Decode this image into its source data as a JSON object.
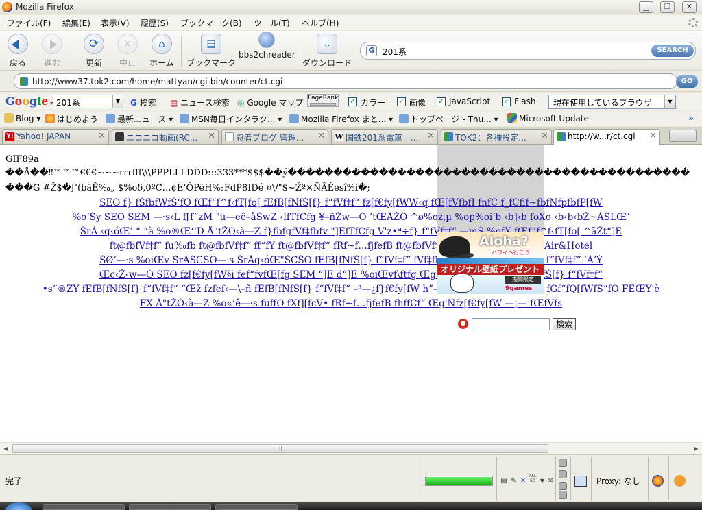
{
  "window": {
    "title": "Mozilla Firefox"
  },
  "menu": [
    "ファイル(F)",
    "編集(E)",
    "表示(V)",
    "履歴(S)",
    "ブックマーク(B)",
    "ツール(T)",
    "ヘルプ(H)"
  ],
  "nav": {
    "back": "戻る",
    "forward": "進む",
    "reload": "更新",
    "stop": "中止",
    "home": "ホーム",
    "bookmarks": "ブックマーク",
    "bbs2chreader": "bbs2chreader",
    "download": "ダウンロード"
  },
  "search": {
    "value": "201系",
    "button": "SEARCH"
  },
  "url": {
    "value": "http://www37.tok2.com/home/mattyan/cgi-bin/counter/ct.cgi",
    "go": "GO"
  },
  "googlebar": {
    "logo_g1": "G",
    "logo_o1": "o",
    "logo_o2": "o",
    "logo_g2": "g",
    "logo_l": "l",
    "logo_e": "e",
    "input": "201系",
    "search": "検索",
    "news": "ニュース検索",
    "maps": "Google マップ",
    "pagerank": "PageRank",
    "color": "カラー",
    "image": "画像",
    "javascript": "JavaScript",
    "flash": "Flash",
    "browser": "現在使用しているブラウザ"
  },
  "bookmarks": [
    "Blog",
    "はじめよう",
    "最新ニュース",
    "MSN毎日インタラク...",
    "Mozilla Firefox まと...",
    "トップページ - Thu...",
    "Microsoft Update"
  ],
  "tabs": [
    "Yahoo! JAPAN",
    "ニコニコ動画(RC...",
    "忍者ブログ 管理...",
    "国鉄201系電車 - ...",
    "TOK2：各種設定...",
    "http://w...r/ct.cgi"
  ],
  "content": {
    "header": "GIF89a",
    "garbled_1": "��Å��‼™™™€€€~~~rrrfff\\\\\\PPPLLLDDD:::333***$$$��ý��������������������������������������������",
    "garbled_2": "���G #Ž$�ƒ‘(bàÊ‰„ $%oδ,0ºC…¢È‘ÔPëH‰FdP8IDé ¤\\/\"$~Žª×ÑÂÉesî%i�;",
    "links": [
      "SEO f} fŠfbfWfŠ‘fO fŒf“f^f‹fT[fo[ fEfB[fNfŠ[f} f“fVf‡f“ fz[f€fy[fWW‹q fŒ[fVfbfI  fnfC f_fCfif~fbfNfpfbfP[fW",
      "%o‘Šy SEO SEM —·s‹L f[f“zM \"ü—eê–åŠwZ ‹lfTfCfg ¥–ñŽw—Ó ’tŒÄŽÔ ^ø%oz,µ %op%oi‘b  ‹b]‹b foXo ‹b‹b‹bŽ~ÁŠLŒ’",
      "ŠrÀ ‹q‹óŒ’ “ “à %o®Œ‘‘D Å\"tŽÒ‹à—Z f}fbfgfVf‡fbfv \"]EfTfCfg V'z•ª÷f} f“fVf‡f“ —mŠ  %ofX fŒf“f^f‹fT[fo[ ^ãŽt“]E",
      "ft@fbfVf‡f“ fu‰fb ft@fbfVf‡f“ ff“fY ft@fbfVf‡f“ fRf~f…fjfefB ft@fbfVf‡ @fbfVf‡f“ %oi‘â‹Ÿ—{ Air&Hotel",
      "ŠØ‘—·s %oiŒv ŠrÀŠCŠO—·s ŠrÀq‹óŒ\"ŠCŠO fEfB[fNfŠ[f} f“fVf‡f“ fVf‡fbfsf“fOf‚[f fEfB[fNfŠ[f} f“fVf‡f“ ’À‘Ý",
      "Œc‹Ž‹w—Ó SEO fz[f€fy[fW§i fef“fvfŒ[fg SEM “]E d“]E %oiŒvf\\ftfg Œg‘Ñ“d˜b –Æ‹–‡h“ f} f“fXfŠ[f} f“fVf‡f“",
      "•s“®ŽY fEfB[fNfŠ[f} f“fVf‡f“ “Œž fzfef‹—\\–ñ fEfB[fNfŠ[f} f“fVf‡f“ –³—¿f}f€fy[fW h”—\\–ñ ŠrASCSO –³—¿HP fGf“fQ[fWfŠ“fO FÊŒY'è",
      "FX Å\"tŽÒ‹à—Z %o«‘ê—·s fuffO fXf][fcV• fRf~f…fjfefB fhffCf“ Œg'Ñfz[f€fy[fW —¡— fŒfVfs"
    ],
    "ad_aloha": "Aloha?",
    "ad_tagline": "ハワイへ行こう",
    "ad_present": "オリジナル壁紙プレゼント",
    "ad_limited": "期間限定",
    "ad_brand": "9games",
    "search_button": "検索"
  },
  "status": {
    "text": "完了",
    "proxy": "Proxy: なし",
    "progress_percent": 100
  }
}
